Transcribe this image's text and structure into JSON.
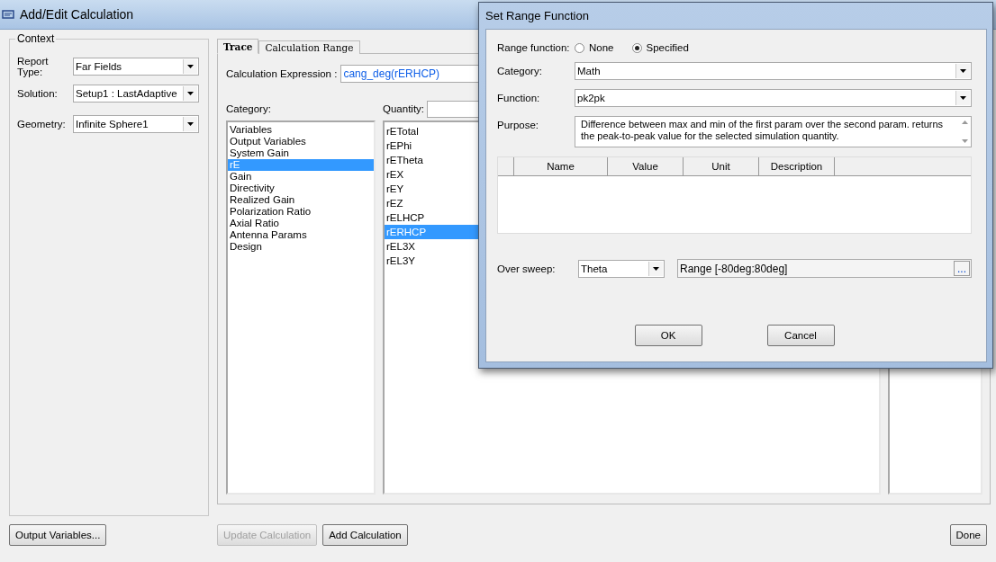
{
  "window": {
    "title": "Add/Edit Calculation"
  },
  "context": {
    "title": "Context",
    "fields": [
      {
        "label": "Report Type:",
        "value": "Far Fields"
      },
      {
        "label": "Solution:",
        "value": "Setup1 : LastAdaptive"
      },
      {
        "label": "Geometry:",
        "value": "Infinite Sphere1"
      }
    ]
  },
  "tabs": [
    {
      "label": "Trace",
      "selected": true
    },
    {
      "label": "Calculation Range",
      "selected": false
    }
  ],
  "expression": {
    "label": "Calculation Expression :",
    "value": "cang_deg(rERHCP)"
  },
  "category": {
    "label": "Category:",
    "items": [
      {
        "label": "Variables",
        "selected": false
      },
      {
        "label": "Output Variables",
        "selected": false
      },
      {
        "label": "System Gain",
        "selected": false
      },
      {
        "label": "rE",
        "selected": true
      },
      {
        "label": "Gain",
        "selected": false
      },
      {
        "label": "Directivity",
        "selected": false
      },
      {
        "label": "Realized Gain",
        "selected": false
      },
      {
        "label": "Polarization Ratio",
        "selected": false
      },
      {
        "label": "Axial Ratio",
        "selected": false
      },
      {
        "label": "Antenna Params",
        "selected": false
      },
      {
        "label": "Design",
        "selected": false
      }
    ]
  },
  "quantity": {
    "label": "Quantity:",
    "items": [
      {
        "label": "rETotal",
        "selected": false
      },
      {
        "label": "rEPhi",
        "selected": false
      },
      {
        "label": "rETheta",
        "selected": false
      },
      {
        "label": "rEX",
        "selected": false
      },
      {
        "label": "rEY",
        "selected": false
      },
      {
        "label": "rEZ",
        "selected": false
      },
      {
        "label": "rELHCP",
        "selected": false
      },
      {
        "label": "rERHCP",
        "selected": true
      },
      {
        "label": "rEL3X",
        "selected": false
      },
      {
        "label": "rEL3Y",
        "selected": false
      }
    ]
  },
  "buttons": [
    {
      "label": "Output Variables...",
      "disabled": false
    },
    {
      "label": "Update Calculation",
      "disabled": true
    },
    {
      "label": "Add Calculation",
      "disabled": false
    },
    {
      "label": "Done",
      "disabled": false
    }
  ],
  "dialog": {
    "title": "Set Range Function",
    "range_function": {
      "label": "Range function:",
      "options": [
        {
          "label": "None",
          "selected": false
        },
        {
          "label": "Specified",
          "selected": true
        }
      ]
    },
    "category": {
      "label": "Category:",
      "value": "Math"
    },
    "function": {
      "label": "Function:",
      "value": "pk2pk"
    },
    "purpose": {
      "label": "Purpose:",
      "text": "Difference between max and min of the first param over the second param. returns the peak-to-peak value for the selected simulation quantity."
    },
    "table": {
      "columns": [
        "Name",
        "Value",
        "Unit",
        "Description"
      ]
    },
    "over_sweep": {
      "label": "Over sweep:",
      "value": "Theta",
      "range": "Range [-80deg:80deg]",
      "browse": "..."
    },
    "buttons": [
      "OK",
      "Cancel"
    ]
  }
}
